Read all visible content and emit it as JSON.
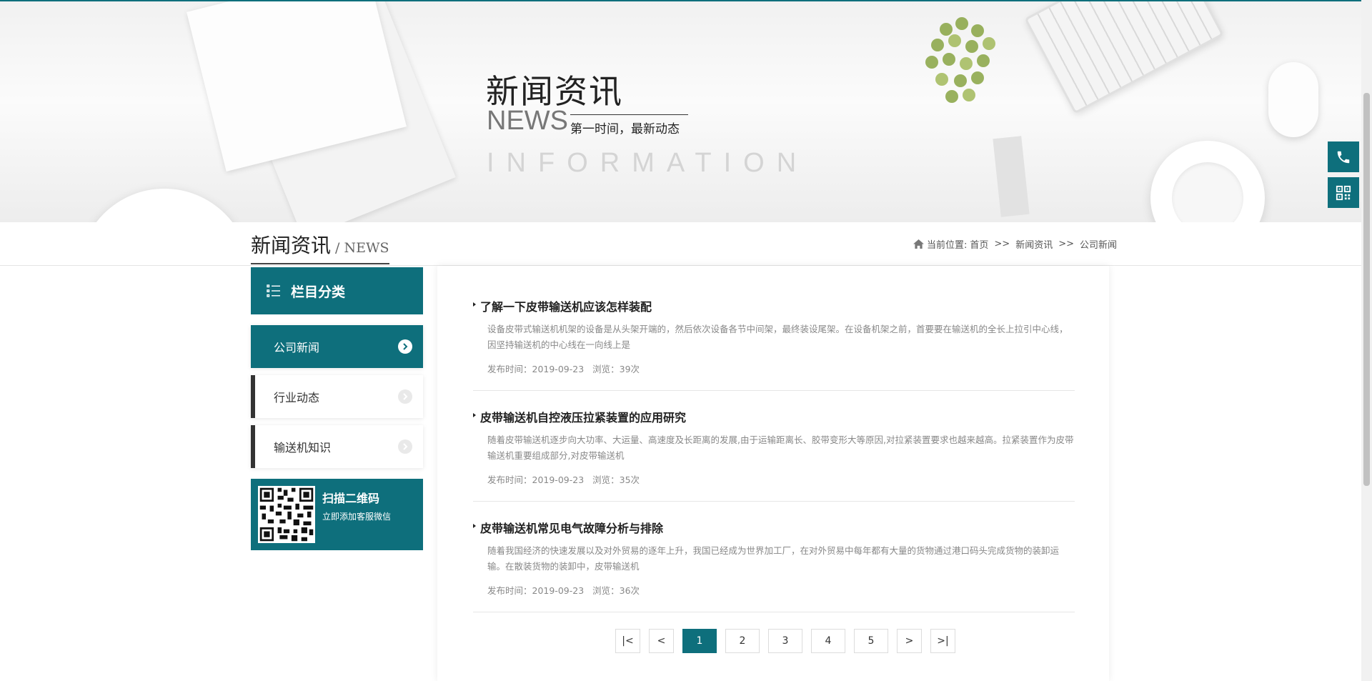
{
  "banner": {
    "title": "新闻资讯",
    "news_en": "NEWS",
    "subtitle": "第一时间，最新动态",
    "info_en": "INFORMATION"
  },
  "page_title": {
    "cn": "新闻资讯",
    "en": "/ NEWS"
  },
  "breadcrumb": {
    "label": "当前位置:",
    "items": [
      "首页",
      "新闻资讯",
      "公司新闻"
    ],
    "separator": ">>"
  },
  "sidebar": {
    "heading": "栏目分类",
    "items": [
      {
        "label": "公司新闻",
        "active": true
      },
      {
        "label": "行业动态",
        "active": false
      },
      {
        "label": "输送机知识",
        "active": false
      }
    ],
    "qr_title": "扫描二维码",
    "qr_sub": "立即添加客服微信"
  },
  "news": [
    {
      "title": "了解一下皮带输送机应该怎样装配",
      "desc": "设备皮带式输送机机架的设备是从头架开端的，然后依次设备各节中间架，最终装设尾架。在设备机架之前，首要要在输送机的全长上拉引中心线，因坚持输送机的中心线在一向线上是",
      "date": "发布时间：2019-09-23",
      "views": "浏览：39次"
    },
    {
      "title": "皮带输送机自控液压拉紧装置的应用研究",
      "desc": "随着皮带输送机逐步向大功率、大运量、高速度及长距离的发展,由于运输距离长、胶带变形大等原因,对拉紧装置要求也越来越高。拉紧装置作为皮带输送机重要组成部分,对皮带输送机",
      "date": "发布时间：2019-09-23",
      "views": "浏览：35次"
    },
    {
      "title": "皮带输送机常见电气故障分析与排除",
      "desc": "随着我国经济的快速发展以及对外贸易的逐年上升，我国已经成为世界加工厂，在对外贸易中每年都有大量的货物通过港口码头完成货物的装卸运输。在散装货物的装卸中，皮带输送机",
      "date": "发布时间：2019-09-23",
      "views": "浏览：36次"
    }
  ],
  "pagination": {
    "first": "|<",
    "prev": "<",
    "pages": [
      "1",
      "2",
      "3",
      "4",
      "5"
    ],
    "current": "1",
    "next": ">",
    "last": ">|"
  },
  "colors": {
    "accent": "#0e6f7c"
  },
  "icons": {
    "float": [
      "phone-icon",
      "qrcode-icon"
    ],
    "sidebar_head": "list-icon",
    "item_arrow": "chevron-right-circle-icon",
    "breadcrumb": "home-icon"
  }
}
